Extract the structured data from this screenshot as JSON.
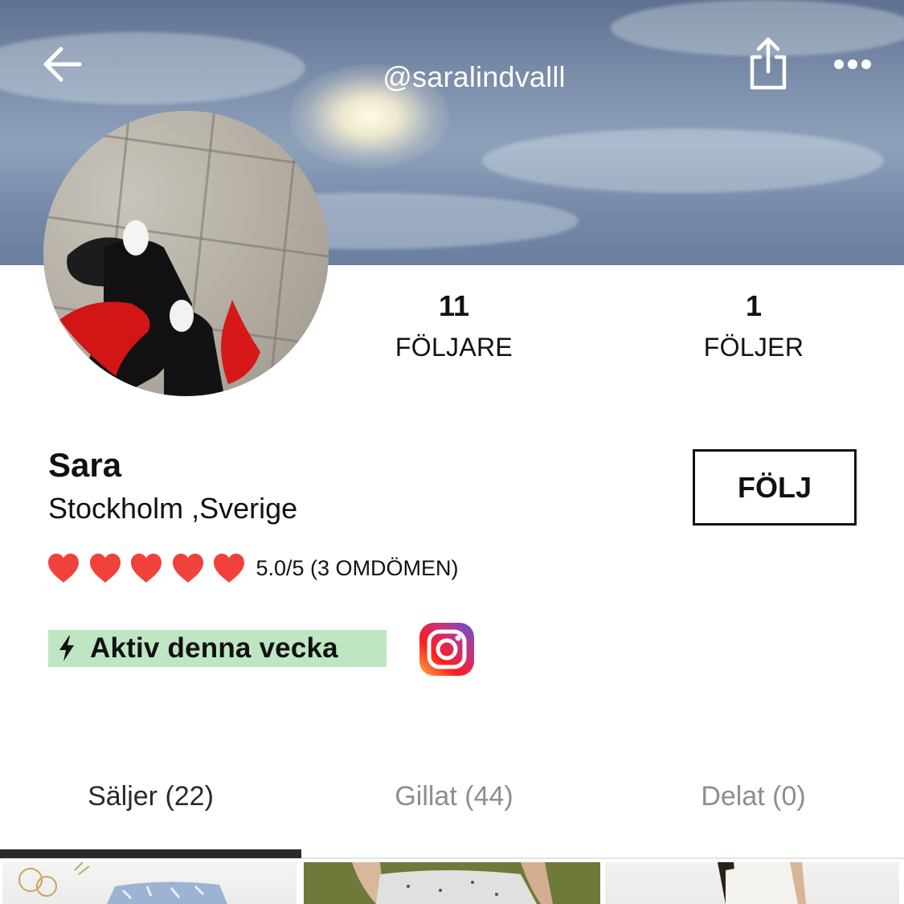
{
  "header": {
    "username": "@saralindvalll",
    "back_icon": "arrow-left-icon",
    "share_icon": "share-icon",
    "more_icon": "more-dots-icon"
  },
  "stats": {
    "followers_count": "11",
    "followers_label": "FÖLJARE",
    "following_count": "1",
    "following_label": "FÖLJER"
  },
  "profile": {
    "name": "Sara",
    "location": "Stockholm ,Sverige",
    "follow_button": "FÖLJ",
    "rating_hearts": 5,
    "rating_text": "5.0/5 (3 OMDÖMEN)",
    "active_badge": "Aktiv denna vecka",
    "instagram_icon": "instagram-icon"
  },
  "tabs": [
    {
      "label": "Säljer (22)",
      "active": true
    },
    {
      "label": "Gillat (44)",
      "active": false
    },
    {
      "label": "Delat (0)",
      "active": false
    }
  ],
  "colors": {
    "heart": "#f0413a",
    "active_badge_bg": "#bfe6c2",
    "tab_indicator": "#2b2b2b"
  }
}
